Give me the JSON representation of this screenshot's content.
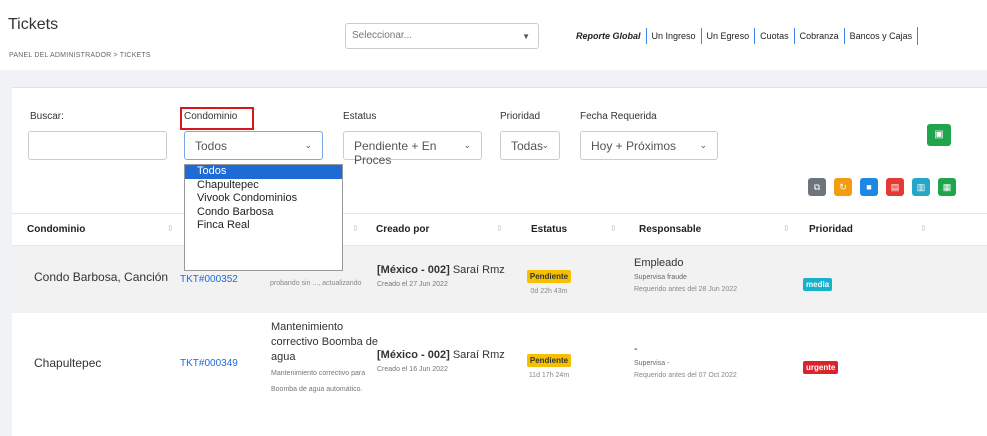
{
  "header": {
    "title": "Tickets",
    "breadcrumb": "PANEL DEL ADMINISTRADOR > TICKETS",
    "select_placeholder": "Seleccionar...",
    "links": [
      "Reporte Global",
      "Un Ingreso",
      "Un Egreso",
      "Cuotas",
      "Cobranza",
      "Bancos y Cajas"
    ]
  },
  "filters": {
    "buscar_label": "Buscar:",
    "condominio_label": "Condominio",
    "condominio_value": "Todos",
    "estatus_label": "Estatus",
    "estatus_value": "Pendiente + En Proces",
    "prioridad_label": "Prioridad",
    "prioridad_value": "Todas",
    "fecha_label": "Fecha Requerida",
    "fecha_value": "Hoy + Próximos"
  },
  "dropdown": {
    "options": [
      "Todos",
      "Chapultepec",
      "Vivook Condominios",
      "Condo Barbosa",
      "Finca Real"
    ]
  },
  "tools": [
    "copy-icon",
    "refresh-icon",
    "print-icon",
    "pdf-icon",
    "file-icon",
    "excel-icon"
  ],
  "colors": {
    "copy": "#6c757d",
    "refresh": "#f39c12",
    "print": "#1e88e5",
    "pdf": "#e53935",
    "file": "#26a6c9",
    "excel": "#20a44c",
    "add": "#20a44c",
    "highlight": "#d8161b"
  },
  "table": {
    "headers": [
      "Condominio",
      "",
      "",
      "Creado por",
      "Estatus",
      "Responsable",
      "Prioridad"
    ],
    "rows": [
      {
        "condominio": "Condo Barbosa, Canción",
        "ticket": "TKT#000352",
        "desc_main": "",
        "desc_sub": "probando sin ..., actualizando",
        "creado_code": "[México - 002]",
        "creado_name": "Saraí Rmz",
        "creado_date": "Creado el 27 Jun 2022",
        "estatus": "Pendiente",
        "estatus_time": "0d 22h 43m",
        "resp_main": "Empleado",
        "resp_sub": "Supervisa fraude",
        "resp_req": "Requerido antes del 28 Jun 2022",
        "prioridad": "media"
      },
      {
        "condominio": "Chapultepec",
        "ticket": "TKT#000349",
        "desc_line1": "Mantenimiento",
        "desc_line2": "correctivo Boomba de",
        "desc_line3": "agua",
        "desc_sub1": "Mantenimiento correctivo para",
        "desc_sub2": "Boomba de agua automático.",
        "creado_code": "[México - 002]",
        "creado_name": "Saraí Rmz",
        "creado_date": "Creado el 16 Jun 2022",
        "estatus": "Pendiente",
        "estatus_time": "11d 17h 24m",
        "resp_main": "-",
        "resp_sub": "Supervisa -",
        "resp_req": "Requerido antes del 07 Oct 2022",
        "prioridad": "urgente"
      }
    ]
  }
}
